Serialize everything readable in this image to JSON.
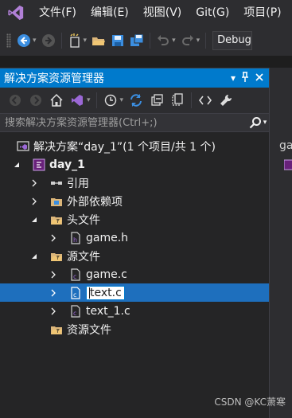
{
  "menubar": {
    "logo_icon": "visual-studio-logo-icon",
    "items": [
      "文件(F)",
      "编辑(E)",
      "视图(V)",
      "Git(G)",
      "项目(P)"
    ]
  },
  "toolbar": {
    "configuration": "Debug"
  },
  "solution_explorer": {
    "title": "解决方案资源管理器",
    "search_placeholder": "搜索解决方案资源管理器(Ctrl+;)",
    "tree": {
      "solution": "解决方案“day_1”(1 个项目/共 1 个)",
      "project": "day_1",
      "references": "引用",
      "external_dependencies": "外部依赖项",
      "header_files": "头文件",
      "header_file_1": "game.h",
      "source_files": "源文件",
      "source_file_1": "game.c",
      "source_file_2_rename_value": "text.c",
      "source_file_3": "text_1.c",
      "resource_files": "资源文件"
    }
  },
  "right_panel": {
    "tab": "ga"
  },
  "watermark": "CSDN @KC萧寒",
  "colors": {
    "accent": "#007acc",
    "selection": "#1e6fbd",
    "background": "#252526",
    "chrome": "#2d2d30"
  }
}
